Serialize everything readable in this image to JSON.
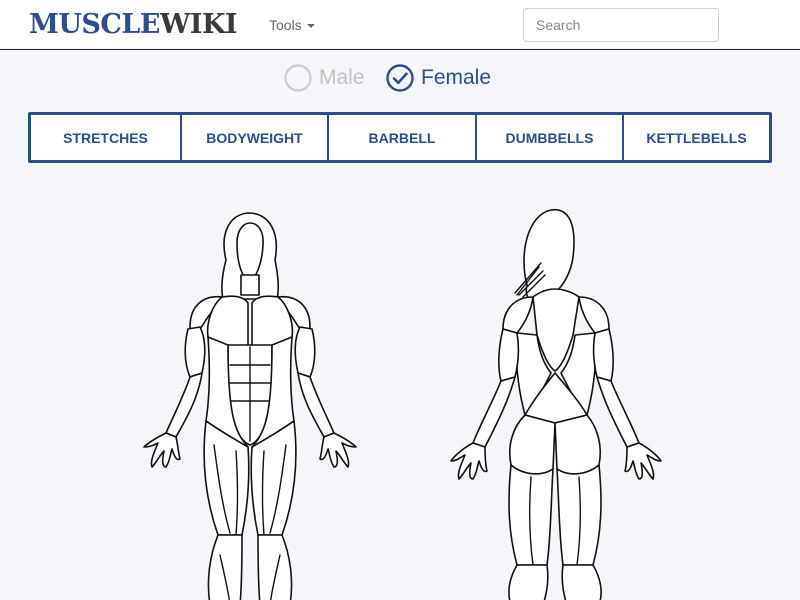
{
  "header": {
    "logo_part1": "MUSCLE",
    "logo_part2": "WIKI",
    "tools_label": "Tools",
    "search_placeholder": "Search",
    "search_value": ""
  },
  "gender": {
    "male_label": "Male",
    "female_label": "Female",
    "selected": "Female"
  },
  "categories": [
    "STRETCHES",
    "BODYWEIGHT",
    "BARBELL",
    "DUMBBELLS",
    "KETTLEBELLS"
  ],
  "colors": {
    "brand": "#2d4d8c",
    "logo_secondary": "#3a3a3a",
    "background": "#f4f6f9",
    "inactive": "#c3c3c3"
  }
}
